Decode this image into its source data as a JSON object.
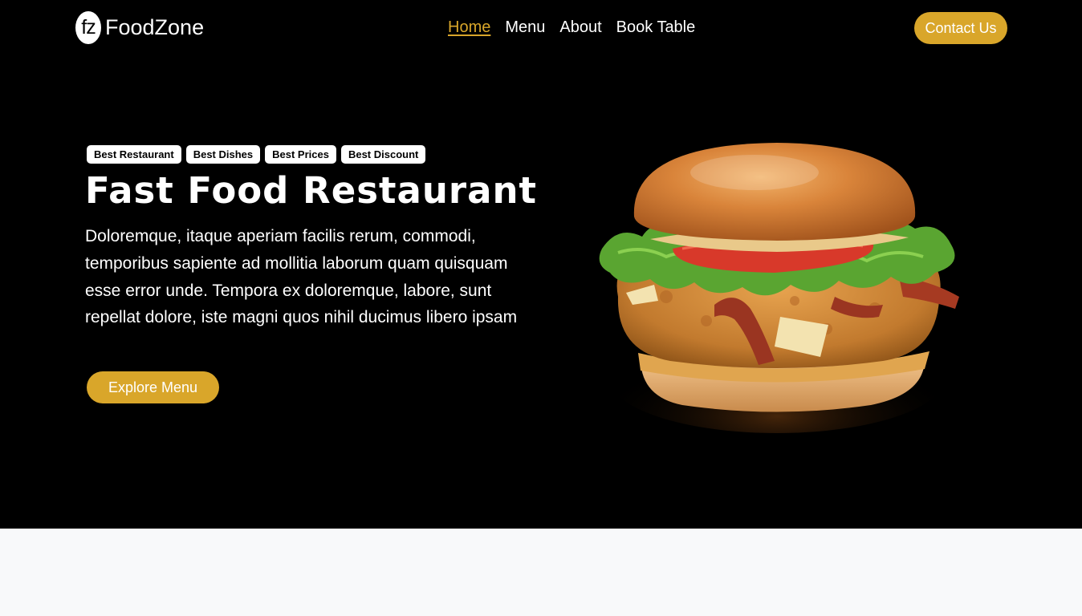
{
  "brand": {
    "logo_mark": "fz",
    "name": "FoodZone"
  },
  "nav": {
    "items": [
      {
        "label": "Home",
        "active": true
      },
      {
        "label": "Menu",
        "active": false
      },
      {
        "label": "About",
        "active": false
      },
      {
        "label": "Book Table",
        "active": false
      }
    ],
    "contact_label": "Contact Us"
  },
  "hero": {
    "badges": [
      "Best Restaurant",
      "Best Dishes",
      "Best Prices",
      "Best Discount"
    ],
    "title": "Fast Food Restaurant",
    "description": "Doloremque, itaque aperiam facilis rerum, commodi, temporibus sapiente ad mollitia laborum quam quisquam esse error unde. Tempora ex doloremque, labore, sunt repellat dolore, iste magni quos nihil ducimus libero ipsam",
    "cta_label": "Explore Menu",
    "image_icon": "burger-image"
  },
  "colors": {
    "accent": "#d9a62a",
    "hero_bg": "#000000",
    "page_bg": "#f8f9fa"
  }
}
